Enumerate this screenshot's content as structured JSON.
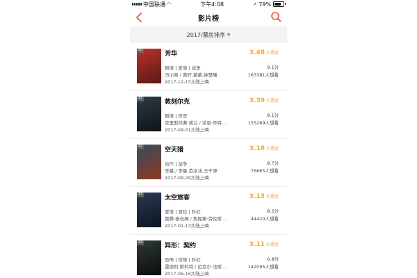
{
  "status_bar": {
    "carrier": "中国联通",
    "time": "下午4:08",
    "battery": "79%",
    "battery_level": 0.79
  },
  "nav": {
    "title": "影片榜",
    "back_icon": "chevron-left-icon",
    "search_icon": "search-icon"
  },
  "filter": {
    "label": "2017/票房排序"
  },
  "accent_color": "#f5a623",
  "movies": [
    {
      "rank": "40",
      "title": "芳华",
      "genre": "剧情 | 爱情 | 战争",
      "cast": "冯小刚 / 黄轩,苗苗,钟楚曦",
      "date": "2017-12-15大陆上映",
      "box_value": "3.48",
      "box_unit": "亿票房",
      "score": "9.1分",
      "want": "163381人想看",
      "poster_colors": [
        "#b8322a",
        "#5a1a14"
      ]
    },
    {
      "rank": "41",
      "title": "敦刻尔克",
      "genre": "剧情 | 历史",
      "cast": "克里斯托弗·诺兰 / 菲恩·怀特...",
      "date": "2017-09-01大陆上映",
      "box_value": "3.39",
      "box_unit": "亿票房",
      "score": "8.1分",
      "want": "155289人想看",
      "poster_colors": [
        "#2c3a44",
        "#0f1418"
      ]
    },
    {
      "rank": "42",
      "title": "空天猎",
      "genre": "动作 | 战争",
      "cast": "李晨 / 李晨,范冰冰,王千源",
      "date": "2017-09-29大陆上映",
      "box_value": "3.18",
      "box_unit": "亿票房",
      "score": "8.7分",
      "want": "76665人想看",
      "poster_colors": [
        "#3a4a5e",
        "#8a3a22"
      ]
    },
    {
      "rank": "43",
      "title": "太空旅客",
      "genre": "爱情 | 冒险 | 科幻",
      "cast": "莫腾·泰杜姆 / 詹妮弗·劳伦斯...",
      "date": "2017-01-13大陆上映",
      "box_value": "3.13",
      "box_unit": "亿票房",
      "score": "8.5分",
      "want": "44420人想看",
      "poster_colors": [
        "#2a3b55",
        "#0c1420"
      ]
    },
    {
      "rank": "44",
      "title": "异形：契约",
      "genre": "恐怖 | 惊悚 | 科幻",
      "cast": "雷德利·斯科特 / 迈克尔·法斯...",
      "date": "2017-06-16大陆上映",
      "box_value": "3.11",
      "box_unit": "亿票房",
      "score": "6.8分",
      "want": "142095人想看",
      "poster_colors": [
        "#2f3a36",
        "#0a0c0b"
      ]
    }
  ]
}
